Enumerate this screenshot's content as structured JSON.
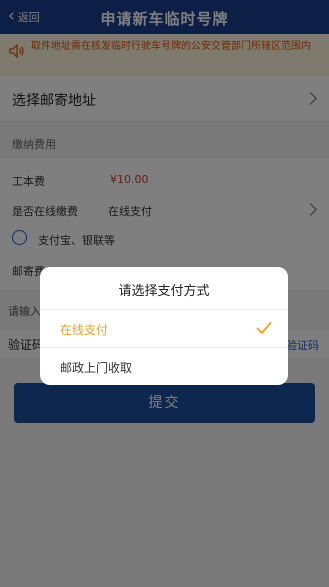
{
  "header": {
    "back_label": "返回",
    "title": "申请新车临时号牌"
  },
  "notice": {
    "text": "取件地址需在核发临时行驶车号牌的公安交管部门所辖区范围内"
  },
  "address": {
    "label": "选择邮寄地址"
  },
  "fees": {
    "section_title": "缴纳费用",
    "cost_label": "工本费",
    "cost_value": "¥10.00",
    "online_pay_label": "是否在线缴费",
    "online_pay_value": "在线支付",
    "payment_option": "支付宝、银联等",
    "postage_label": "邮寄费"
  },
  "applicant": {
    "label": "请输入"
  },
  "verify": {
    "label": "验证码",
    "get_code": "验证码"
  },
  "submit": {
    "label": "提交"
  },
  "dialog": {
    "title": "请选择支付方式",
    "options": [
      {
        "label": "在线支付",
        "selected": true
      },
      {
        "label": "邮政上门收取",
        "selected": false
      }
    ]
  },
  "colors": {
    "header_bg": "#1a3e8c",
    "accent_orange": "#f0a020",
    "price_red": "#d0382a",
    "notice_text": "#e2550a"
  }
}
